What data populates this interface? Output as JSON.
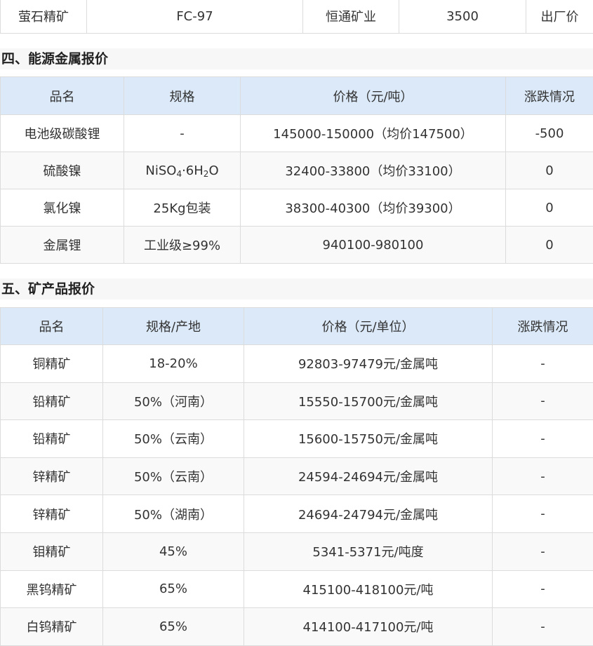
{
  "top_row": {
    "cells": [
      "萤石精矿",
      "FC-97",
      "恒通矿业",
      "3500",
      "出厂价"
    ]
  },
  "energy_section": {
    "title": "四、能源金属报价",
    "headers": [
      "品名",
      "规格",
      "价格（元/吨）",
      "涨跌情况"
    ],
    "rows": [
      {
        "name": "电池级碳酸锂",
        "spec": "-",
        "price": "145000-150000（均价147500）",
        "change": "-500"
      },
      {
        "name": "硫酸镍",
        "spec_parts": [
          "NiSO",
          "4",
          "·6H",
          "2",
          "O"
        ],
        "price": "32400-33800（均价33100）",
        "change": "0"
      },
      {
        "name": "氯化镍",
        "spec": "25Kg包装",
        "price": "38300-40300（均价39300）",
        "change": "0"
      },
      {
        "name": "金属锂",
        "spec": "工业级≥99%",
        "price": "940100-980100",
        "change": "0"
      }
    ]
  },
  "mineral_section": {
    "title": "五、矿产品报价",
    "headers": [
      "品名",
      "规格/产地",
      "价格（元/单位）",
      "涨跌情况"
    ],
    "rows": [
      {
        "name": "铜精矿",
        "spec": "18-20%",
        "price": "92803-97479元/金属吨",
        "change": "-"
      },
      {
        "name": "铅精矿",
        "spec": "50%（河南）",
        "price": "15550-15700元/金属吨",
        "change": "-"
      },
      {
        "name": "铅精矿",
        "spec": "50%（云南）",
        "price": "15600-15750元/金属吨",
        "change": "-"
      },
      {
        "name": "锌精矿",
        "spec": "50%（云南）",
        "price": "24594-24694元/金属吨",
        "change": "-"
      },
      {
        "name": "锌精矿",
        "spec": "50%（湖南）",
        "price": "24694-24794元/金属吨",
        "change": "-"
      },
      {
        "name": "钼精矿",
        "spec": "45%",
        "price": "5341-5371元/吨度",
        "change": "-"
      },
      {
        "name": "黑钨精矿",
        "spec": "65%",
        "price": "415100-418100元/吨",
        "change": "-"
      },
      {
        "name": "白钨精矿",
        "spec": "65%",
        "price": "414100-417100元/吨",
        "change": "-"
      }
    ]
  },
  "colors": {
    "header_bg": "#dbe9f8",
    "section_bg": "#f7f7f7",
    "row_alt_bg": "#f9f9f9",
    "border": "#dcdcdc",
    "text": "#333333"
  }
}
